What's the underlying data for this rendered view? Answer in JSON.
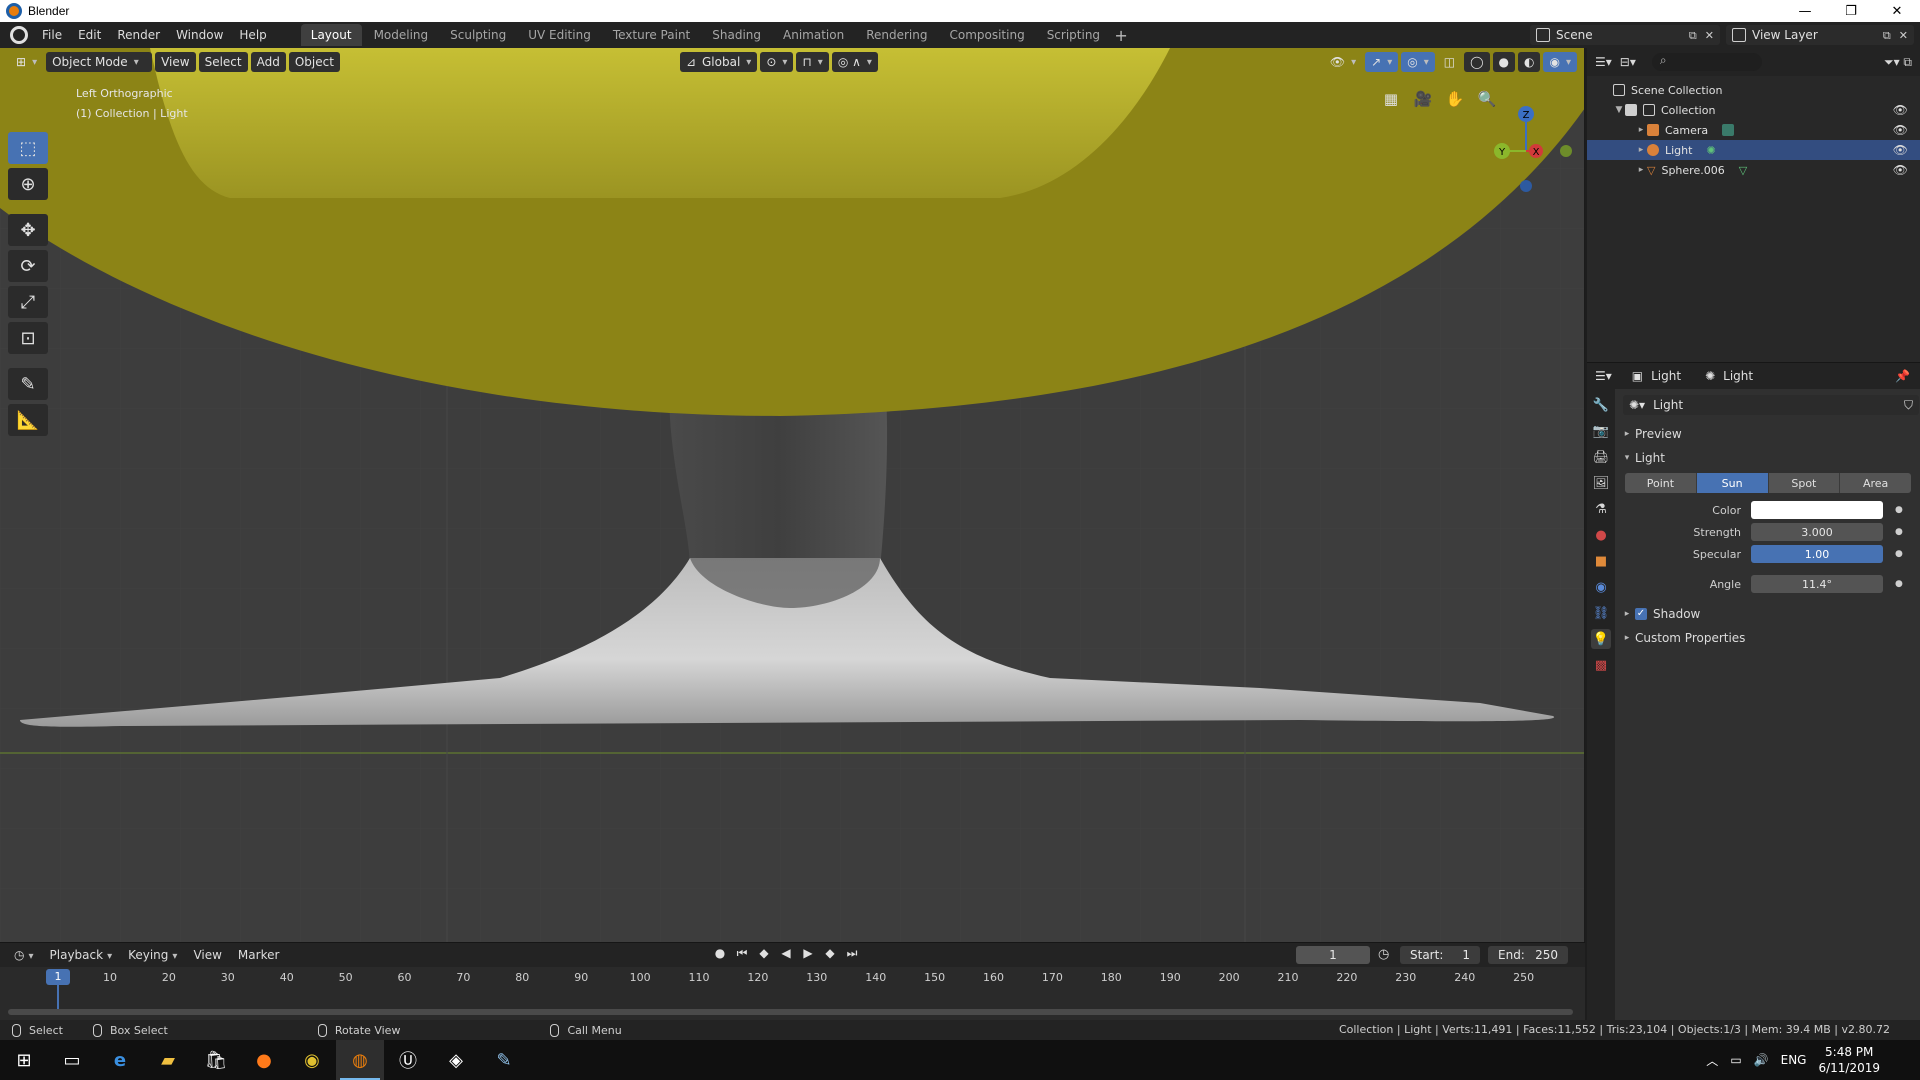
{
  "window": {
    "title": "Blender",
    "controls": [
      "—",
      "❐",
      "✕"
    ]
  },
  "menu": [
    "File",
    "Edit",
    "Render",
    "Window",
    "Help"
  ],
  "workspaces": [
    {
      "label": "Layout",
      "active": true
    },
    {
      "label": "Modeling"
    },
    {
      "label": "Sculpting"
    },
    {
      "label": "UV Editing"
    },
    {
      "label": "Texture Paint"
    },
    {
      "label": "Shading"
    },
    {
      "label": "Animation"
    },
    {
      "label": "Rendering"
    },
    {
      "label": "Compositing"
    },
    {
      "label": "Scripting"
    }
  ],
  "scene": {
    "name": "Scene",
    "view_layer": "View Layer"
  },
  "viewport": {
    "mode": "Object Mode",
    "menus": [
      "View",
      "Select",
      "Add",
      "Object"
    ],
    "transform_orientation": "Global",
    "view_name": "Left Orthographic",
    "context": "(1) Collection | Light",
    "gizmo": {
      "z": "Z",
      "y": "Y",
      "x": "X"
    }
  },
  "outliner": {
    "root": "Scene Collection",
    "collection": "Collection",
    "items": [
      {
        "name": "Camera",
        "selected": false
      },
      {
        "name": "Light",
        "selected": true
      },
      {
        "name": "Sphere.006",
        "selected": false
      }
    ]
  },
  "properties": {
    "breadcrumb_object": "Light",
    "breadcrumb_data": "Light",
    "datablock_name": "Light",
    "panels": {
      "preview": "Preview",
      "light": "Light",
      "shadow": "Shadow",
      "custom": "Custom Properties"
    },
    "light_types": [
      {
        "label": "Point"
      },
      {
        "label": "Sun",
        "active": true
      },
      {
        "label": "Spot"
      },
      {
        "label": "Area"
      }
    ],
    "fields": {
      "color_label": "Color",
      "color_value": "#ffffff",
      "strength_label": "Strength",
      "strength": "3.000",
      "specular_label": "Specular",
      "specular": "1.00",
      "angle_label": "Angle",
      "angle": "11.4°"
    },
    "shadow_enabled": true
  },
  "timeline": {
    "menus": [
      "Playback",
      "Keying",
      "View",
      "Marker"
    ],
    "current_frame": "1",
    "start_label": "Start:",
    "start": "1",
    "end_label": "End:",
    "end": "250",
    "ruler": [
      "1",
      "10",
      "20",
      "30",
      "40",
      "50",
      "60",
      "70",
      "80",
      "90",
      "100",
      "110",
      "120",
      "130",
      "140",
      "150",
      "160",
      "170",
      "180",
      "190",
      "200",
      "210",
      "220",
      "230",
      "240",
      "250"
    ]
  },
  "statusbar": {
    "select": "Select",
    "box_select": "Box Select",
    "rotate_view": "Rotate View",
    "call_menu": "Call Menu",
    "stats": "Collection | Light | Verts:11,491 | Faces:11,552 | Tris:23,104 | Objects:1/3 | Mem: 39.4 MB | v2.80.72"
  },
  "taskbar": {
    "time": "5:48 PM",
    "date": "6/11/2019",
    "lang": "ENG"
  },
  "colors": {
    "accent": "#4772b3",
    "yellow_object": "#c0b82c",
    "viewport_bg": "#3d3d3d"
  }
}
